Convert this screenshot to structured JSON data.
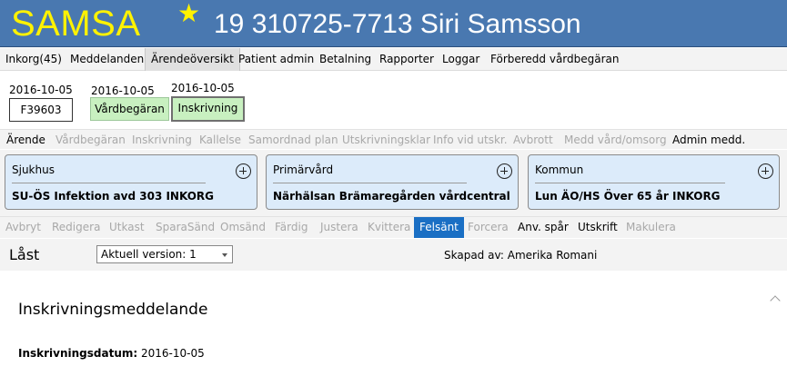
{
  "header": {
    "logo": "SAMSA",
    "star": "★",
    "patient": "19 310725-7713 Siri Samsson"
  },
  "menu": [
    {
      "label": "Inkorg(45)",
      "active": false
    },
    {
      "label": "Meddelanden",
      "active": false
    },
    {
      "label": "Ärendeöversikt",
      "active": true
    },
    {
      "label": "Patient admin",
      "active": false
    },
    {
      "label": "Betalning",
      "active": false
    },
    {
      "label": "Rapporter",
      "active": false
    },
    {
      "label": "Loggar",
      "active": false
    },
    {
      "label": "Förberedd vårdbegäran",
      "active": false
    }
  ],
  "case": {
    "date": "2016-10-05",
    "id": "F39603"
  },
  "statuses": [
    {
      "date": "2016-10-05",
      "label": "Vårdbegäran",
      "selected": false
    },
    {
      "date": "2016-10-05",
      "label": "Inskrivning",
      "selected": true
    }
  ],
  "tabs": [
    {
      "label": "Ärende",
      "enabled": true
    },
    {
      "label": "Vårdbegäran",
      "enabled": false
    },
    {
      "label": "Inskrivning",
      "enabled": false
    },
    {
      "label": "Kallelse",
      "enabled": false
    },
    {
      "label": "Samordnad plan",
      "enabled": false
    },
    {
      "label": "Utskrivningsklar",
      "enabled": false
    },
    {
      "label": "Info vid utskr.",
      "enabled": false
    },
    {
      "label": "Avbrott",
      "enabled": false
    },
    {
      "label": "Medd vård/omsorg",
      "enabled": false
    },
    {
      "label": "Admin medd.",
      "enabled": true
    }
  ],
  "cards": [
    {
      "title": "Sjukhus",
      "value": "SU-ÖS Infektion avd 303 INKORG"
    },
    {
      "title": "Primärvård",
      "value": "Närhälsan Brämaregården vårdcentral"
    },
    {
      "title": "Kommun",
      "value": "Lun ÄO/HS Över 65 år INKORG"
    }
  ],
  "actions": [
    {
      "label": "Avbryt",
      "state": "disabled"
    },
    {
      "label": "Redigera",
      "state": "disabled"
    },
    {
      "label": "Utkast",
      "state": "disabled"
    },
    {
      "label": "SparaSänd",
      "state": "disabled"
    },
    {
      "label": "Omsänd",
      "state": "disabled"
    },
    {
      "label": "Färdig",
      "state": "disabled"
    },
    {
      "label": "Justera",
      "state": "disabled"
    },
    {
      "label": "Kvittera",
      "state": "disabled"
    },
    {
      "label": "Felsänt",
      "state": "active"
    },
    {
      "label": "Forcera",
      "state": "disabled"
    },
    {
      "label": "Anv. spår",
      "state": "enabled"
    },
    {
      "label": "Utskrift",
      "state": "enabled"
    },
    {
      "label": "Makulera",
      "state": "disabled"
    }
  ],
  "lock": {
    "label": "Låst",
    "version": "Aktuell version: 1",
    "created_by": "Skapad av: Amerika Romani"
  },
  "document": {
    "title": "Inskrivningsmeddelande",
    "field_label": "Inskrivningsdatum:",
    "field_value": "2016-10-05"
  },
  "colors": {
    "header_bg": "#4978b0",
    "logo": "#fff200",
    "status_green": "#c8f0c0",
    "card_blue": "#dcebfa",
    "active_action": "#1a6fc4"
  }
}
